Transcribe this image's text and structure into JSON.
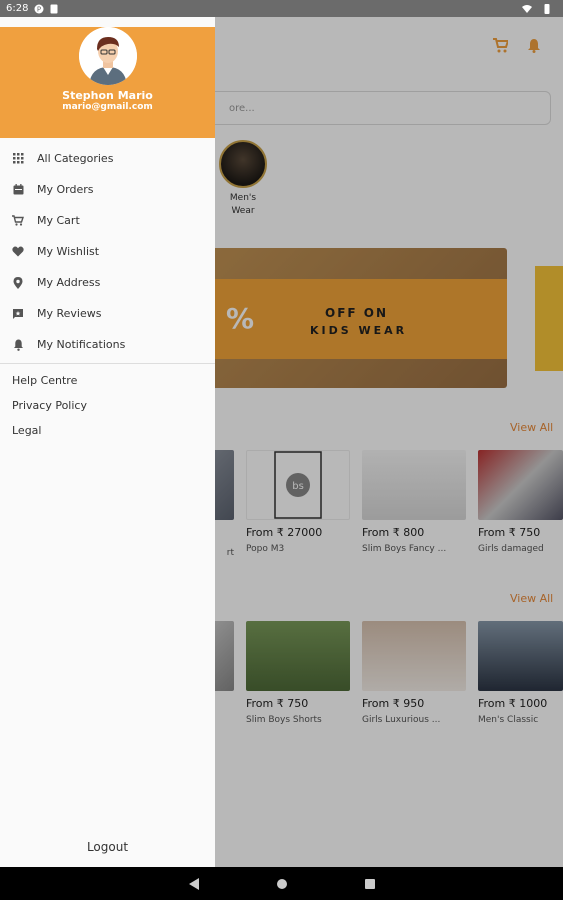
{
  "status_bar": {
    "time": "6:28"
  },
  "drawer": {
    "user": {
      "name": "Stephon Mario",
      "email": "mario@gmail.com"
    },
    "menu": [
      {
        "label": "All Categories",
        "icon": "grid-icon"
      },
      {
        "label": "My Orders",
        "icon": "calendar-icon"
      },
      {
        "label": "My Cart",
        "icon": "cart-icon"
      },
      {
        "label": "My Wishlist",
        "icon": "heart-icon"
      },
      {
        "label": "My Address",
        "icon": "location-icon"
      },
      {
        "label": "My Reviews",
        "icon": "review-icon"
      },
      {
        "label": "My Notifications",
        "icon": "bell-icon"
      }
    ],
    "links": [
      "Help Centre",
      "Privacy Policy",
      "Legal"
    ],
    "logout_label": "Logout"
  },
  "background": {
    "search_placeholder": "ore...",
    "category": {
      "label": "Men's Wear"
    },
    "banner": {
      "percent": "%",
      "line1": "OFF ON",
      "line2": "KIDS WEAR"
    },
    "view_all": "View All",
    "row1": [
      {
        "price": "",
        "name": "rt"
      },
      {
        "price": "From  ₹ 27000",
        "name": "Popo M3"
      },
      {
        "price": "From  ₹ 800",
        "name": "Slim Boys Fancy ..."
      },
      {
        "price": "From  ₹ 750",
        "name": "Girls damaged"
      }
    ],
    "row2": [
      {
        "price": "",
        "name": ""
      },
      {
        "price": "From  ₹ 750",
        "name": "Slim Boys Shorts"
      },
      {
        "price": "From  ₹ 950",
        "name": "Girls Luxurious ..."
      },
      {
        "price": "From  ₹ 1000",
        "name": "Men's Classic"
      }
    ]
  },
  "colors": {
    "accent": "#f0a03f",
    "link_orange": "#e88a3a"
  }
}
